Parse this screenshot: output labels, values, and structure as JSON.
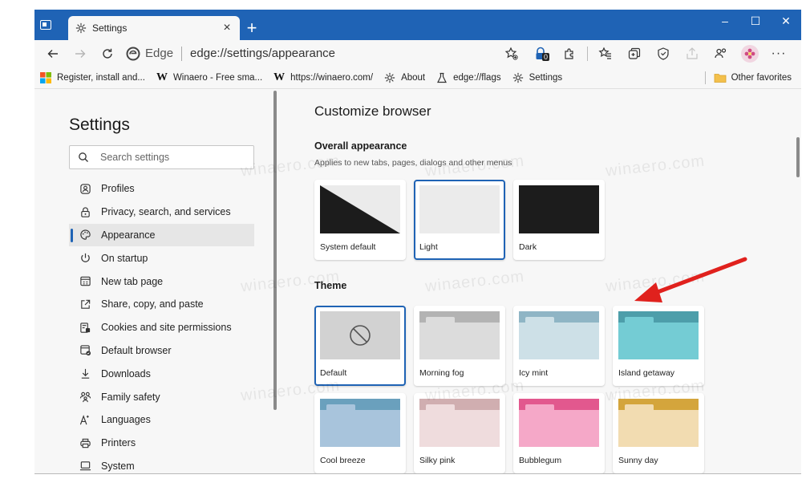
{
  "window": {
    "tab_title": "Settings",
    "new_tab_label": "+",
    "controls": {
      "minimize": "–",
      "maximize": "☐",
      "close": "✕"
    }
  },
  "toolbar": {
    "edge_label": "Edge",
    "url": "edge://settings/appearance",
    "tracking_badge": "0"
  },
  "favorites": {
    "items": [
      {
        "label": "Register, install and...",
        "icon": "windows-logo-icon"
      },
      {
        "label": "Winaero - Free sma...",
        "icon": "winaero-w-icon"
      },
      {
        "label": "https://winaero.com/",
        "icon": "winaero-w-icon"
      },
      {
        "label": "About",
        "icon": "gear-icon"
      },
      {
        "label": "edge://flags",
        "icon": "flask-icon"
      },
      {
        "label": "Settings",
        "icon": "gear-icon"
      }
    ],
    "other_favorites": "Other favorites",
    "logo_letter": "W"
  },
  "sidebar": {
    "title": "Settings",
    "search_placeholder": "Search settings",
    "items": [
      {
        "label": "Profiles",
        "icon": "profile-icon"
      },
      {
        "label": "Privacy, search, and services",
        "icon": "lock-icon"
      },
      {
        "label": "Appearance",
        "icon": "palette-icon"
      },
      {
        "label": "On startup",
        "icon": "power-icon"
      },
      {
        "label": "New tab page",
        "icon": "new-tab-icon"
      },
      {
        "label": "Share, copy, and paste",
        "icon": "share-icon"
      },
      {
        "label": "Cookies and site permissions",
        "icon": "cookies-icon"
      },
      {
        "label": "Default browser",
        "icon": "default-browser-icon"
      },
      {
        "label": "Downloads",
        "icon": "download-icon"
      },
      {
        "label": "Family safety",
        "icon": "family-icon"
      },
      {
        "label": "Languages",
        "icon": "languages-icon"
      },
      {
        "label": "Printers",
        "icon": "printer-icon"
      },
      {
        "label": "System",
        "icon": "system-icon"
      }
    ],
    "selected_index": 2
  },
  "main": {
    "heading": "Customize browser",
    "overall": {
      "heading": "Overall appearance",
      "description": "Applies to new tabs, pages, dialogs and other menus",
      "options": [
        {
          "label": "System default"
        },
        {
          "label": "Light",
          "selected": true
        },
        {
          "label": "Dark"
        }
      ]
    },
    "theme": {
      "heading": "Theme",
      "options": [
        {
          "label": "Default",
          "selected": true,
          "colors": {
            "tab": "#c8c8c8",
            "body": "#d2d2d2"
          }
        },
        {
          "label": "Morning fog",
          "colors": {
            "tab": "#b3b3b3",
            "front": "#dcdcdc",
            "body": "#dcdcdc"
          }
        },
        {
          "label": "Icy mint",
          "colors": {
            "tab": "#8fb5c5",
            "front": "#cde0e7",
            "body": "#cde0e7"
          }
        },
        {
          "label": "Island getaway",
          "colors": {
            "tab": "#4d9eaa",
            "front": "#74ccd4",
            "body": "#74ccd4"
          }
        },
        {
          "label": "Cool breeze",
          "colors": {
            "tab": "#6aa0bd",
            "front": "#a8c4dc",
            "body": "#a8c4dc"
          }
        },
        {
          "label": "Silky pink",
          "colors": {
            "tab": "#d0aeb0",
            "front": "#efdcdd",
            "body": "#efdcdd"
          }
        },
        {
          "label": "Bubblegum",
          "colors": {
            "tab": "#e2588e",
            "front": "#f5a8c8",
            "body": "#f5a8c8"
          }
        },
        {
          "label": "Sunny day",
          "colors": {
            "tab": "#d4a53c",
            "front": "#f2dcb1",
            "body": "#f2dcb1"
          }
        }
      ]
    }
  },
  "colors": {
    "accent": "#1f63b5",
    "annotation_arrow": "#e0211d"
  }
}
